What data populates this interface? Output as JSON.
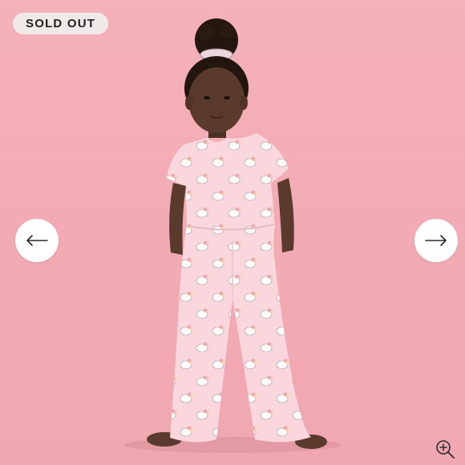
{
  "badge": {
    "label": "SOLD OUT"
  },
  "gallery": {
    "prev_icon": "arrow-left-icon",
    "next_icon": "arrow-right-icon",
    "zoom_icon": "zoom-in-icon"
  },
  "colors": {
    "background": "#f2aab3",
    "badge_bg": "#efe9e8",
    "badge_text": "#1f1f1f",
    "nav_button": "#ffffff",
    "jumpsuit": "#f9d7dc",
    "skin": "#5a3a2c"
  }
}
